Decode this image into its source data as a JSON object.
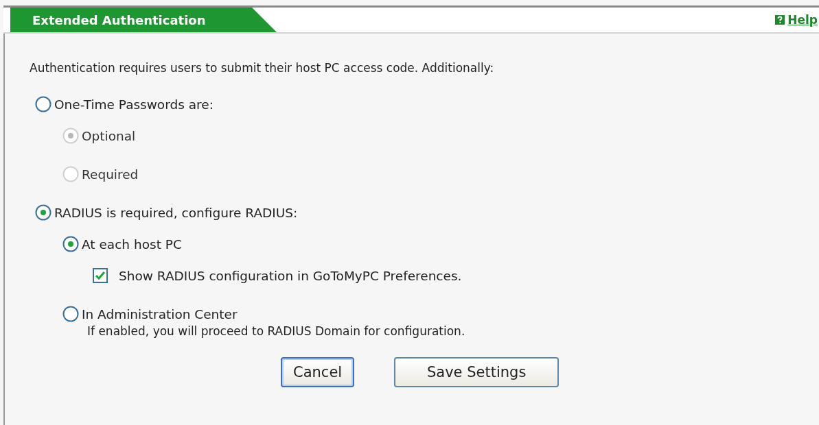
{
  "header": {
    "title": "Extended Authentication",
    "help": "Help"
  },
  "intro": "Authentication requires users to submit their host PC access code. Additionally:",
  "options": [
    {
      "kind": "radio",
      "label": "One-Time Passwords are:",
      "selected": false,
      "disabled": false,
      "children": [
        {
          "kind": "radio",
          "label": "Optional",
          "selected": true,
          "disabled": true
        },
        {
          "kind": "radio",
          "label": "Required",
          "selected": false,
          "disabled": true
        }
      ]
    },
    {
      "kind": "radio",
      "label": "RADIUS is required, configure RADIUS:",
      "selected": true,
      "disabled": false,
      "children": [
        {
          "kind": "radio",
          "label": "At each host PC",
          "selected": true,
          "disabled": false,
          "children": [
            {
              "kind": "checkbox",
              "label": "Show RADIUS configuration in GoToMyPC Preferences.",
              "checked": true
            }
          ]
        },
        {
          "kind": "radio",
          "label": "In Administration Center",
          "selected": false,
          "disabled": false,
          "note": "If enabled, you will proceed to RADIUS Domain for configuration."
        }
      ]
    }
  ],
  "buttons": [
    {
      "label": "Cancel",
      "focused": true
    },
    {
      "label": "Save Settings",
      "focused": false
    }
  ]
}
